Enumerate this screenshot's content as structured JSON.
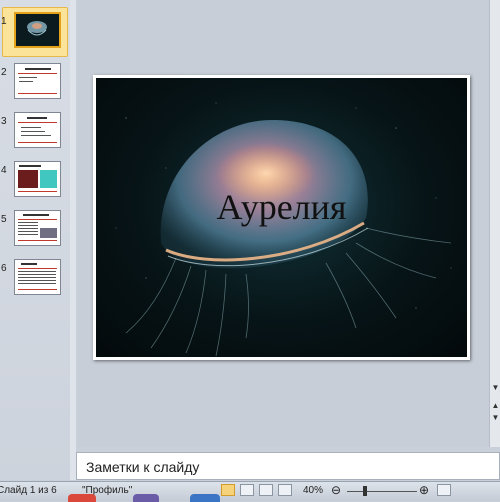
{
  "thumbnails": [
    {
      "number": "1",
      "selected": true
    },
    {
      "number": "2",
      "selected": false
    },
    {
      "number": "3",
      "selected": false
    },
    {
      "number": "4",
      "selected": false
    },
    {
      "number": "5",
      "selected": false
    },
    {
      "number": "6",
      "selected": false
    }
  ],
  "slide": {
    "title": "Аурелия",
    "image": "jellyfish-photo"
  },
  "notes": {
    "placeholder": "Заметки к слайду"
  },
  "status_bar": {
    "slide_counter": "Слайд 1 из 6",
    "theme_name": "\"Профиль\"",
    "zoom_level": "40%",
    "zoom_out_icon": "minus-circle-icon",
    "zoom_in_icon": "plus-circle-icon"
  },
  "colors": {
    "selection": "#fbe49a",
    "selection_border": "#e6b84a",
    "panel": "#c7ced8"
  }
}
